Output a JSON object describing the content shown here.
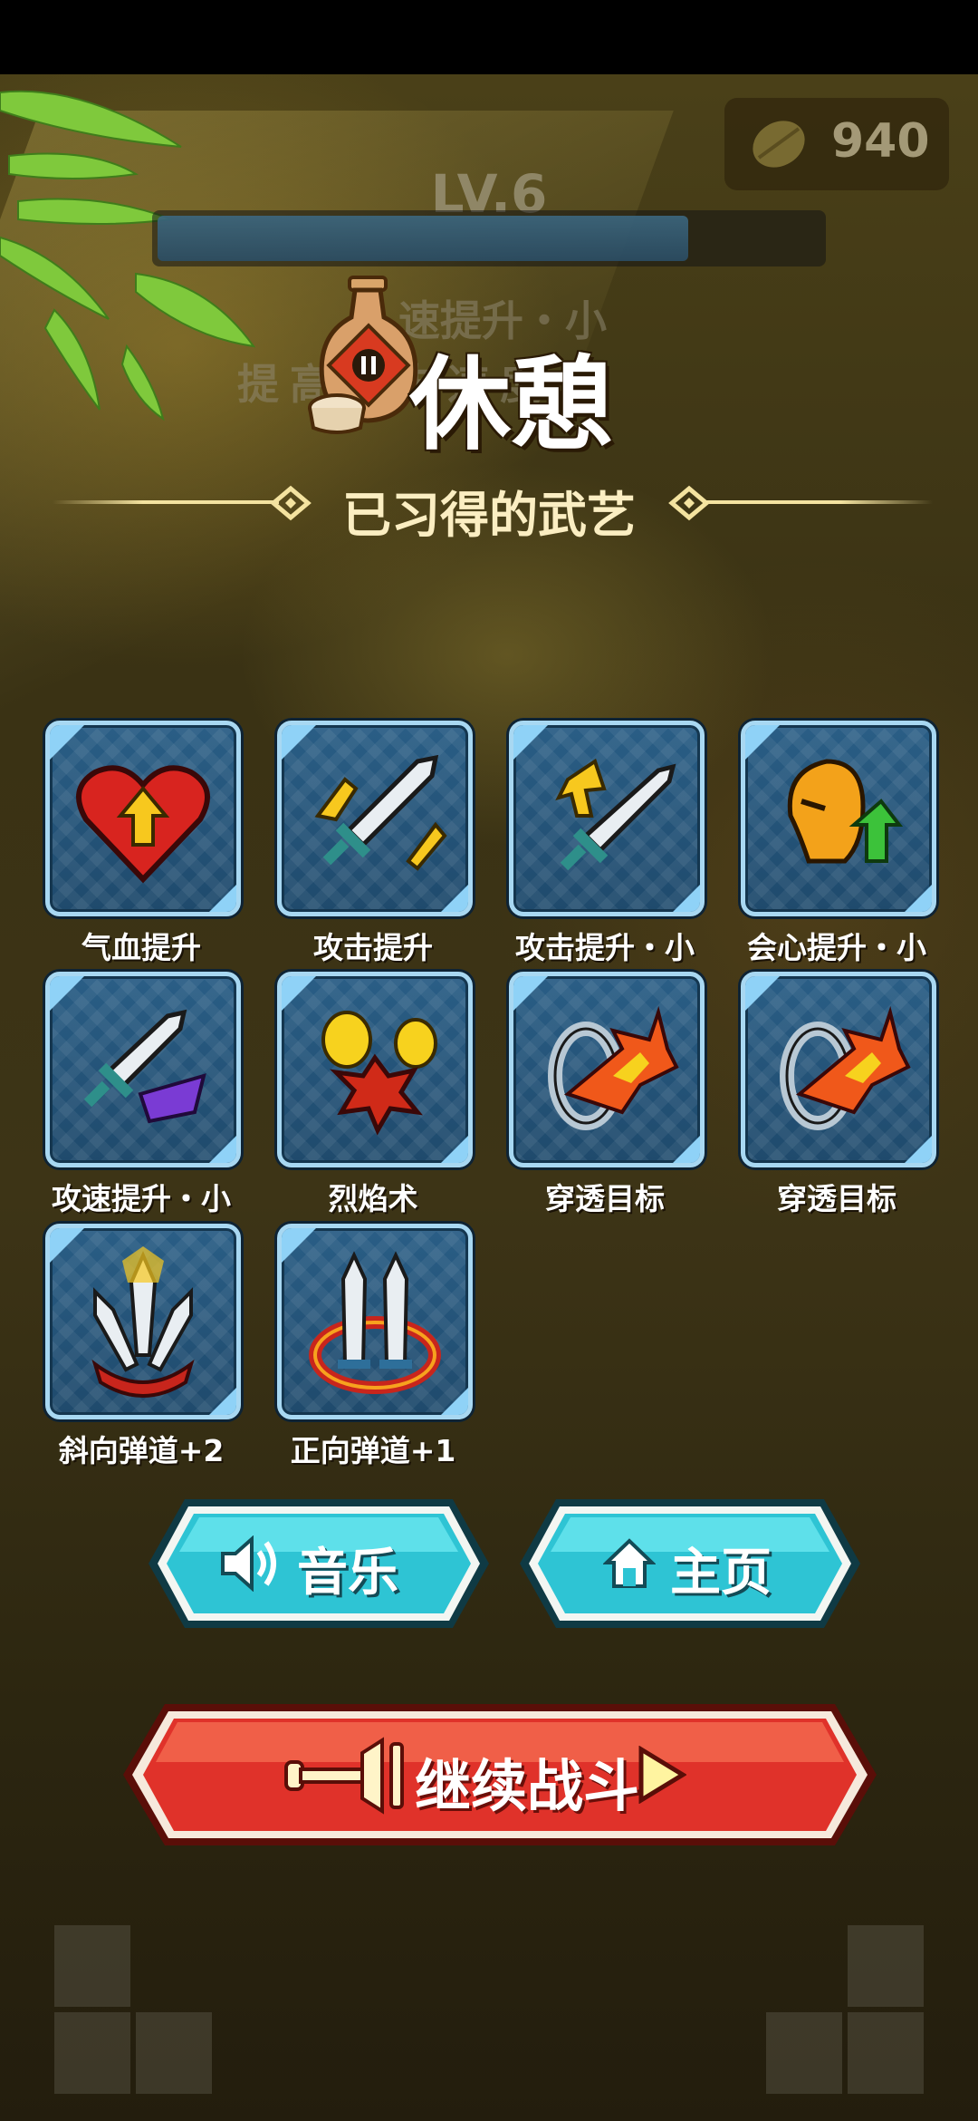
{
  "hud": {
    "coins": "940",
    "level": "LV.6",
    "xp_progress": 0.8,
    "background_skill_name": "速提升・小",
    "background_skill_desc": "提高攻击速度"
  },
  "pause": {
    "title": "休憩",
    "section_title": "已习得的武艺"
  },
  "skills": [
    {
      "label": "气血提升",
      "icon": "heart-up-icon"
    },
    {
      "label": "攻击提升",
      "icon": "sword-double-arrow-icon"
    },
    {
      "label": "攻击提升・小",
      "icon": "sword-arrow-icon"
    },
    {
      "label": "会心提升・小",
      "icon": "critical-head-icon"
    },
    {
      "label": "攻速提升・小",
      "icon": "sword-speed-icon"
    },
    {
      "label": "烈焰术",
      "icon": "flame-burst-icon"
    },
    {
      "label": "穿透目标",
      "icon": "pierce-ring-icon"
    },
    {
      "label": "穿透目标",
      "icon": "pierce-ring-icon"
    },
    {
      "label": "斜向弹道+2",
      "icon": "diagonal-swords-icon"
    },
    {
      "label": "正向弹道+1",
      "icon": "forward-swords-icon"
    }
  ],
  "buttons": {
    "music": "音乐",
    "home": "主页",
    "continue": "继续战斗"
  },
  "colors": {
    "blue_button": "#2ec4d4",
    "red_button": "#e0322a",
    "skill_frame": "#a8d8f2",
    "divider": "#f4e3a0"
  }
}
